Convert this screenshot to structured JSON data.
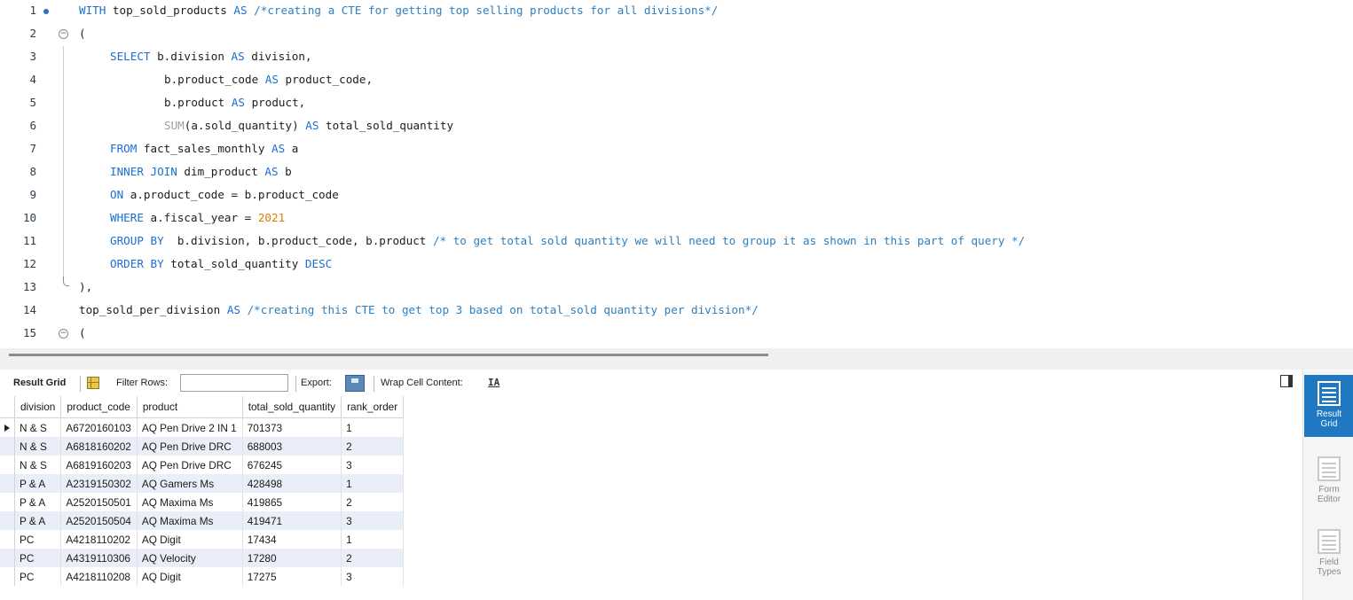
{
  "editor": {
    "lines": [
      {
        "n": "1",
        "dot": true,
        "fold": "",
        "indent": 0,
        "tokens": [
          [
            "kw",
            "WITH"
          ],
          [
            "t",
            " top_sold_products "
          ],
          [
            "kw",
            "AS"
          ],
          [
            "cm",
            " /*creating a CTE for getting top selling products for all divisions*/"
          ]
        ]
      },
      {
        "n": "2",
        "dot": false,
        "fold": "open",
        "indent": 0,
        "tokens": [
          [
            "t",
            "("
          ]
        ]
      },
      {
        "n": "3",
        "dot": false,
        "fold": "mid",
        "indent": 1,
        "tokens": [
          [
            "kw",
            "SELECT"
          ],
          [
            "t",
            " b.division "
          ],
          [
            "kw",
            "AS"
          ],
          [
            "t",
            " division,"
          ]
        ]
      },
      {
        "n": "4",
        "dot": false,
        "fold": "mid",
        "indent": 2,
        "tokens": [
          [
            "t",
            "b.product_code "
          ],
          [
            "kw",
            "AS"
          ],
          [
            "t",
            " product_code,"
          ]
        ]
      },
      {
        "n": "5",
        "dot": false,
        "fold": "mid",
        "indent": 2,
        "tokens": [
          [
            "t",
            "b.product "
          ],
          [
            "kw",
            "AS"
          ],
          [
            "t",
            " product,"
          ]
        ]
      },
      {
        "n": "6",
        "dot": false,
        "fold": "mid",
        "indent": 2,
        "tokens": [
          [
            "fn",
            "SUM"
          ],
          [
            "t",
            "(a.sold_quantity) "
          ],
          [
            "kw",
            "AS"
          ],
          [
            "t",
            " total_sold_quantity"
          ]
        ]
      },
      {
        "n": "7",
        "dot": false,
        "fold": "mid",
        "indent": 1,
        "tokens": [
          [
            "kw",
            "FROM"
          ],
          [
            "t",
            " fact_sales_monthly "
          ],
          [
            "kw",
            "AS"
          ],
          [
            "t",
            " a"
          ]
        ]
      },
      {
        "n": "8",
        "dot": false,
        "fold": "mid",
        "indent": 1,
        "tokens": [
          [
            "kw",
            "INNER JOIN"
          ],
          [
            "t",
            " dim_product "
          ],
          [
            "kw",
            "AS"
          ],
          [
            "t",
            " b"
          ]
        ]
      },
      {
        "n": "9",
        "dot": false,
        "fold": "mid",
        "indent": 1,
        "tokens": [
          [
            "kw",
            "ON"
          ],
          [
            "t",
            " a.product_code = b.product_code"
          ]
        ]
      },
      {
        "n": "10",
        "dot": false,
        "fold": "mid",
        "indent": 1,
        "tokens": [
          [
            "kw",
            "WHERE"
          ],
          [
            "t",
            " a.fiscal_year = "
          ],
          [
            "num",
            "2021"
          ]
        ]
      },
      {
        "n": "11",
        "dot": false,
        "fold": "mid",
        "indent": 1,
        "tokens": [
          [
            "kw",
            "GROUP BY"
          ],
          [
            "t",
            "  b.division, b.product_code, b.product "
          ],
          [
            "cm",
            "/* to get total sold quantity we will need to group it as shown in this part of query */"
          ]
        ]
      },
      {
        "n": "12",
        "dot": false,
        "fold": "mid",
        "indent": 1,
        "tokens": [
          [
            "kw",
            "ORDER BY"
          ],
          [
            "t",
            " total_sold_quantity "
          ],
          [
            "kw",
            "DESC"
          ]
        ]
      },
      {
        "n": "13",
        "dot": false,
        "fold": "end",
        "indent": 0,
        "tokens": [
          [
            "t",
            "),"
          ]
        ]
      },
      {
        "n": "14",
        "dot": false,
        "fold": "",
        "indent": 0,
        "tokens": [
          [
            "t",
            "top_sold_per_division "
          ],
          [
            "kw",
            "AS"
          ],
          [
            "cm",
            " /*creating this CTE to get top 3 based on total_sold quantity per division*/"
          ]
        ]
      },
      {
        "n": "15",
        "dot": false,
        "fold": "open",
        "indent": 0,
        "tokens": [
          [
            "t",
            "("
          ]
        ]
      }
    ]
  },
  "toolbar": {
    "result_grid_label": "Result Grid",
    "filter_rows_label": "Filter Rows:",
    "filter_value": "",
    "export_label": "Export:",
    "wrap_label": "Wrap Cell Content:",
    "wrap_icon_text": "IA"
  },
  "grid": {
    "columns": [
      "division",
      "product_code",
      "product",
      "total_sold_quantity",
      "rank_order"
    ],
    "rows": [
      [
        "N & S",
        "A6720160103",
        "AQ Pen Drive 2 IN 1",
        "701373",
        "1"
      ],
      [
        "N & S",
        "A6818160202",
        "AQ Pen Drive DRC",
        "688003",
        "2"
      ],
      [
        "N & S",
        "A6819160203",
        "AQ Pen Drive DRC",
        "676245",
        "3"
      ],
      [
        "P & A",
        "A2319150302",
        "AQ Gamers Ms",
        "428498",
        "1"
      ],
      [
        "P & A",
        "A2520150501",
        "AQ Maxima Ms",
        "419865",
        "2"
      ],
      [
        "P & A",
        "A2520150504",
        "AQ Maxima Ms",
        "419471",
        "3"
      ],
      [
        "PC",
        "A4218110202",
        "AQ Digit",
        "17434",
        "1"
      ],
      [
        "PC",
        "A4319110306",
        "AQ Velocity",
        "17280",
        "2"
      ],
      [
        "PC",
        "A4218110208",
        "AQ Digit",
        "17275",
        "3"
      ]
    ],
    "selected_row": 0
  },
  "sidepanel": {
    "buttons": [
      {
        "label": "Result Grid",
        "icon": "result-grid-icon",
        "active": true
      },
      {
        "label": "Form Editor",
        "icon": "form-editor-icon",
        "active": false
      },
      {
        "label": "Field Types",
        "icon": "field-types-icon",
        "active": false
      }
    ]
  },
  "colors": {
    "keyword": "#1a6fd1",
    "comment": "#2d7fbf",
    "number": "#e07b00",
    "function": "#9aa0a6",
    "accent": "#1f78c1",
    "alt_row": "#e9eef8"
  }
}
